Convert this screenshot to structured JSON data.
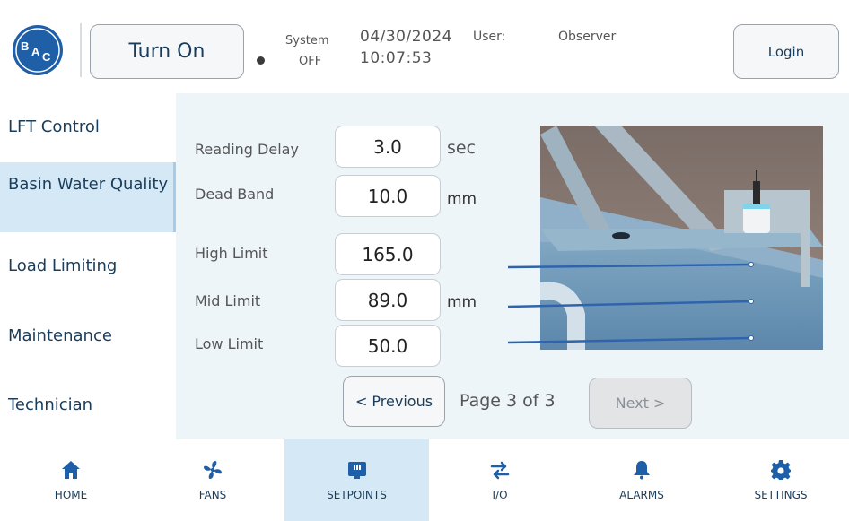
{
  "header": {
    "logo_text": "BAC",
    "turn_on_label": "Turn On",
    "system_label": "System",
    "system_state": "OFF",
    "date": "04/30/2024",
    "time": "10:07:53",
    "user_label": "User:",
    "user_value": "Observer",
    "login_label": "Login"
  },
  "sidebar": {
    "items": [
      {
        "label": "LFT Control",
        "active": false
      },
      {
        "label": "Basin Water Quality",
        "active": true
      },
      {
        "label": "Load Limiting",
        "active": false
      },
      {
        "label": "Maintenance",
        "active": false
      },
      {
        "label": "Technician",
        "active": false
      }
    ]
  },
  "settings": {
    "reading_delay": {
      "label": "Reading Delay",
      "value": "3.0",
      "unit": "sec"
    },
    "dead_band": {
      "label": "Dead Band",
      "value": "10.0",
      "unit": "mm"
    },
    "high_limit": {
      "label": "High Limit",
      "value": "165.0"
    },
    "mid_limit": {
      "label": "Mid Limit",
      "value": "89.0",
      "unit": "mm"
    },
    "low_limit": {
      "label": "Low Limit",
      "value": "50.0"
    }
  },
  "pagination": {
    "previous_label": "< Previous",
    "page_text": "Page 3 of 3",
    "next_label": "Next >"
  },
  "nav": {
    "items": [
      {
        "label": "HOME",
        "icon": "home-icon",
        "active": false
      },
      {
        "label": "FANS",
        "icon": "fan-icon",
        "active": false
      },
      {
        "label": "SETPOINTS",
        "icon": "setpoints-icon",
        "active": true
      },
      {
        "label": "I/O",
        "icon": "io-arrows-icon",
        "active": false
      },
      {
        "label": "ALARMS",
        "icon": "bell-icon",
        "active": false
      },
      {
        "label": "SETTINGS",
        "icon": "gear-icon",
        "active": false
      }
    ]
  },
  "colors": {
    "primary_text": "#1a3d5c",
    "accent_blue": "#1f5fa8",
    "active_bg": "#d5e8f6",
    "panel_bg": "#eef5f9"
  }
}
